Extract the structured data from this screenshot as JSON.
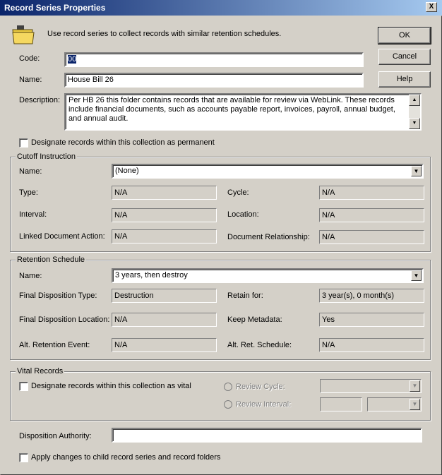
{
  "window": {
    "title": "Record Series Properties",
    "close_glyph": "X"
  },
  "intro": {
    "text": "Use record series to collect records with similar retention schedules."
  },
  "buttons": {
    "ok": "OK",
    "cancel": "Cancel",
    "help": "Help"
  },
  "fields": {
    "code_label": "Code:",
    "code_value": "00",
    "name_label": "Name:",
    "name_value": "House Bill 26",
    "description_label": "Description:",
    "description_value": "Per HB 26 this folder contains records that are available for review via WebLink.  These records include financial documents, such as accounts payable report, invoices, payroll, annual budget, and annual audit.",
    "permanent_label": "Designate records within this collection as permanent",
    "permanent_checked": false
  },
  "cutoff": {
    "legend": "Cutoff Instruction",
    "name_label": "Name:",
    "name_value": "(None)",
    "type_label": "Type:",
    "type_value": "N/A",
    "cycle_label": "Cycle:",
    "cycle_value": "N/A",
    "interval_label": "Interval:",
    "interval_value": "N/A",
    "location_label": "Location:",
    "location_value": "N/A",
    "linked_label": "Linked Document Action:",
    "linked_value": "N/A",
    "relationship_label": "Document Relationship:",
    "relationship_value": "N/A"
  },
  "retention": {
    "legend": "Retention Schedule",
    "name_label": "Name:",
    "name_value": "3 years, then destroy",
    "fdtype_label": "Final Disposition Type:",
    "fdtype_value": "Destruction",
    "retain_label": "Retain for:",
    "retain_value": "3 year(s), 0 month(s)",
    "fdloc_label": "Final Disposition Location:",
    "fdloc_value": "N/A",
    "keep_label": "Keep Metadata:",
    "keep_value": "Yes",
    "altevent_label": "Alt. Retention Event:",
    "altevent_value": "N/A",
    "altsched_label": "Alt. Ret. Schedule:",
    "altsched_value": "N/A"
  },
  "vital": {
    "legend": "Vital Records",
    "checkbox_label": "Designate records within this collection as vital",
    "checked": false,
    "review_cycle_label": "Review Cycle:",
    "review_interval_label": "Review Interval:"
  },
  "disposition": {
    "label": "Disposition Authority:",
    "value": ""
  },
  "apply": {
    "label": "Apply changes to child record series and record folders",
    "checked": false
  },
  "colors": {
    "titlebar_start": "#0a246a",
    "titlebar_end": "#a6caf0",
    "face": "#d4d0c8"
  },
  "icons": {
    "dialog": "folder-icon",
    "dropdown": "chevron-down-icon"
  }
}
